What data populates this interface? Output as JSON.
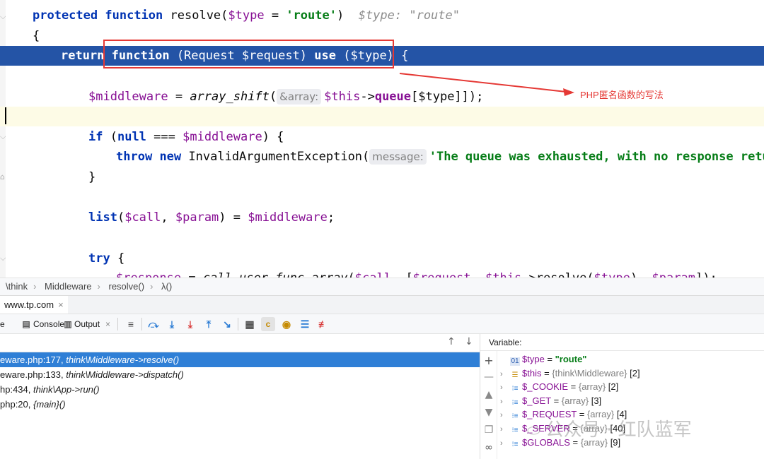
{
  "editor": {
    "lines": {
      "l1": {
        "kw1": "protected",
        "kw2": "function",
        "name": "resolve(",
        "var": "$type",
        "eq": " = ",
        "str": "'route'",
        "close": ")",
        "inlay": "$type: \"route\""
      },
      "l2": {
        "brace": "{"
      },
      "l3": {
        "kw1": "return",
        "kw2": "function",
        "params": "(Request $request)",
        "kw3": "use",
        "captured": "($type) {"
      },
      "l4": {
        "var": "$middleware",
        "eq": " = ",
        "fn": "array_shift",
        "open": "(",
        "hint": "&array:",
        "this": "$this",
        "arrow": "->",
        "prop": "queue",
        "index": "[$type]",
        "end": "]);"
      },
      "l6": {
        "kw": "if",
        "open": " (",
        "null": "null",
        "op": " === ",
        "var": "$middleware",
        "close": ") {"
      },
      "l7": {
        "kw1": "throw",
        "kw2": "new",
        "cls": "InvalidArgumentException(",
        "hint": "message:",
        "str": "'The queue was exhausted, with no response return"
      },
      "l8": {
        "brace": "}"
      },
      "l10": {
        "fn": "list",
        "open": "(",
        "v1": "$call",
        "comma": ", ",
        "v2": "$param",
        "close": ") = ",
        "v3": "$middleware",
        "end": ";"
      },
      "l12": {
        "kw": "try",
        "brace": " {"
      },
      "l13": {
        "v1": "$response",
        "eq": " = ",
        "fn": "call_user_func_array",
        "open": "(",
        "v2": "$call",
        "mid": ", [",
        "v3": "$request",
        "comma": ", ",
        "v4": "$this",
        "arrow": "->",
        "m": "resolve",
        "open2": "(",
        "v5": "$type",
        "close2": "), ",
        "v6": "$param",
        "end": "]);"
      }
    }
  },
  "annotation": {
    "text": "PHP匿名函数的写法",
    "color": "#e53935"
  },
  "breadcrumb": [
    "\\think",
    "Middleware",
    "resolve()",
    "λ()"
  ],
  "debug": {
    "tab": {
      "label": "www.tp.com",
      "close": "×"
    },
    "toolbar": {
      "frames_label": "e",
      "console_label": "Console",
      "output_label": "Output",
      "output_close": "×"
    }
  },
  "frames": {
    "items": [
      {
        "file": "eware.php:177, ",
        "method": "think\\Middleware->resolve()"
      },
      {
        "file": "eware.php:133, ",
        "method": "think\\Middleware->dispatch()"
      },
      {
        "file": "hp:434, ",
        "method": "think\\App->run()"
      },
      {
        "file": "php:20, ",
        "method": "{main}()"
      }
    ]
  },
  "variables": {
    "header": "Variable:",
    "items": [
      {
        "name": "$type",
        "eq": " = ",
        "value": "\"route\"",
        "count": "",
        "icon": "primitive-icon"
      },
      {
        "name": "$this",
        "eq": " = ",
        "value": "{think\\Middleware}",
        "count": " [2]",
        "icon": "object-icon"
      },
      {
        "name": "$_COOKIE",
        "eq": " = ",
        "value": "{array}",
        "count": " [2]",
        "icon": "array-icon"
      },
      {
        "name": "$_GET",
        "eq": " = ",
        "value": "{array}",
        "count": " [3]",
        "icon": "array-icon"
      },
      {
        "name": "$_REQUEST",
        "eq": " = ",
        "value": "{array}",
        "count": " [4]",
        "icon": "array-icon"
      },
      {
        "name": "$_SERVER",
        "eq": " = ",
        "value": "{array}",
        "count": " [40]",
        "icon": "array-icon"
      },
      {
        "name": "$GLOBALS",
        "eq": " = ",
        "value": "{array}",
        "count": " [9]",
        "icon": "array-icon"
      }
    ]
  },
  "watermark": {
    "text": "公众号 · 红队蓝军"
  }
}
